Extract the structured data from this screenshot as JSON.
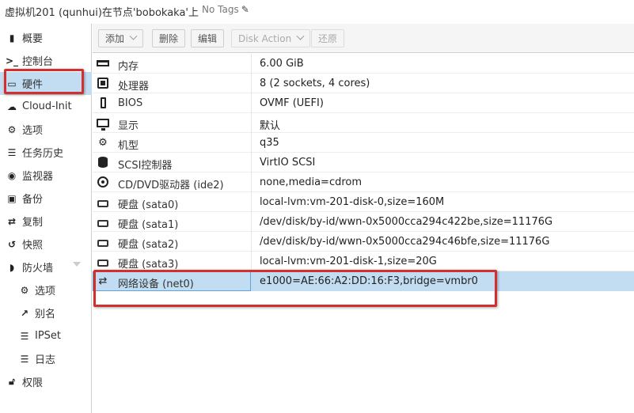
{
  "header": {
    "title": "虚拟机201 (qunhui)在节点'bobokaka'上",
    "tags_label": "No Tags",
    "tags_icon": "pencil-icon"
  },
  "sidebar": {
    "items": [
      {
        "label": "概要",
        "icon": "book-icon"
      },
      {
        "label": "控制台",
        "icon": "terminal-icon"
      },
      {
        "label": "硬件",
        "icon": "desktop-icon"
      },
      {
        "label": "Cloud-Init",
        "icon": "cloud-icon"
      },
      {
        "label": "选项",
        "icon": "gear-icon"
      },
      {
        "label": "任务历史",
        "icon": "list-icon"
      },
      {
        "label": "监视器",
        "icon": "eye-icon"
      },
      {
        "label": "备份",
        "icon": "floppy-icon"
      },
      {
        "label": "复制",
        "icon": "retweet-icon"
      },
      {
        "label": "快照",
        "icon": "history-icon"
      },
      {
        "label": "防火墙",
        "icon": "shield-icon"
      },
      {
        "label": "选项",
        "icon": "gear-icon"
      },
      {
        "label": "别名",
        "icon": "external-link-icon"
      },
      {
        "label": "IPSet",
        "icon": "list-ol-icon"
      },
      {
        "label": "日志",
        "icon": "list-icon"
      },
      {
        "label": "权限",
        "icon": "unlock-icon"
      }
    ]
  },
  "toolbar": {
    "add": "添加",
    "remove": "删除",
    "edit": "编辑",
    "disk_action": "Disk Action",
    "revert": "还原"
  },
  "hardware": [
    {
      "key": "内存",
      "value": "6.00 GiB",
      "icon": "memory-icon"
    },
    {
      "key": "处理器",
      "value": "8 (2 sockets, 4 cores)",
      "icon": "cpu-icon"
    },
    {
      "key": "BIOS",
      "value": "OVMF (UEFI)",
      "icon": "microchip-icon"
    },
    {
      "key": "显示",
      "value": "默认",
      "icon": "desktop-icon"
    },
    {
      "key": "机型",
      "value": "q35",
      "icon": "cogs-icon"
    },
    {
      "key": "SCSI控制器",
      "value": "VirtIO SCSI",
      "icon": "database-icon"
    },
    {
      "key": "CD/DVD驱动器 (ide2)",
      "value": "none,media=cdrom",
      "icon": "cdrom-icon"
    },
    {
      "key": "硬盘 (sata0)",
      "value": "local-lvm:vm-201-disk-0,size=160M",
      "icon": "hdd-icon"
    },
    {
      "key": "硬盘 (sata1)",
      "value": "/dev/disk/by-id/wwn-0x5000cca294c422be,size=11176G",
      "icon": "hdd-icon"
    },
    {
      "key": "硬盘 (sata2)",
      "value": "/dev/disk/by-id/wwn-0x5000cca294c46bfe,size=11176G",
      "icon": "hdd-icon"
    },
    {
      "key": "硬盘 (sata3)",
      "value": "local-lvm:vm-201-disk-1,size=20G",
      "icon": "hdd-icon"
    },
    {
      "key": "网络设备 (net0)",
      "value": "e1000=AE:66:A2:DD:16:F3,bridge=vmbr0",
      "icon": "exchange-icon"
    }
  ],
  "colors": {
    "selected": "#c2ddf2",
    "highlight_box": "#d32f2f"
  }
}
